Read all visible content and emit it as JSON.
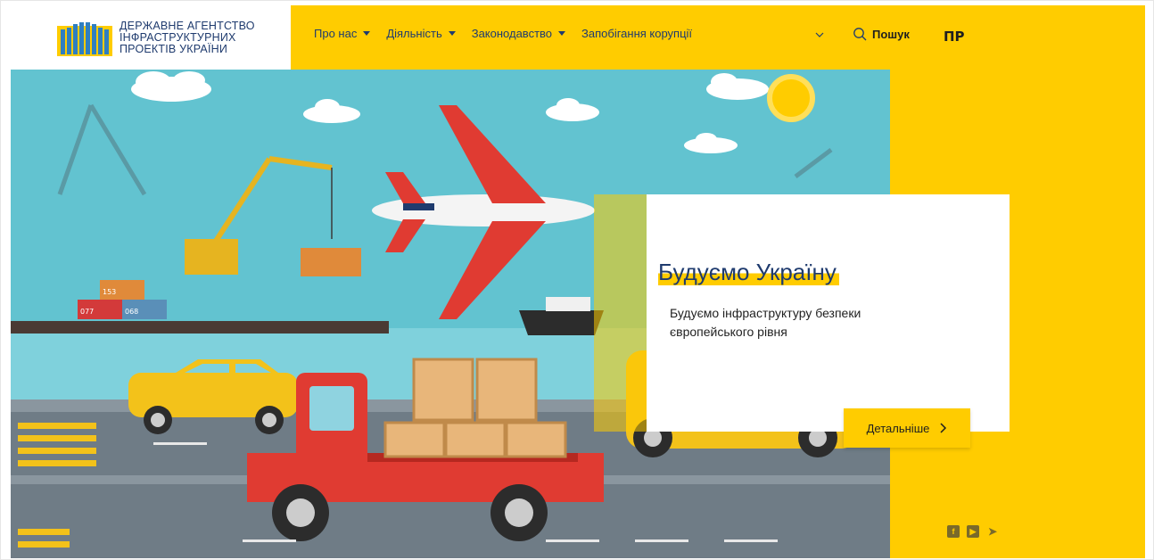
{
  "header": {
    "logo_lines": [
      "ДЕРЖАВНЕ АГЕНТСТВО",
      "ІНФРАСТРУКТУРНИХ",
      "ПРОЕКТІВ УКРАЇНИ"
    ],
    "nav": [
      {
        "label": "Про нас",
        "has_dropdown": true
      },
      {
        "label": "Діяльність",
        "has_dropdown": true
      },
      {
        "label": "Законодавство",
        "has_dropdown": true
      },
      {
        "label": "Запобігання корупції",
        "has_dropdown": false
      }
    ],
    "search_label": "Пошук",
    "brand_icon": "ПР"
  },
  "hero": {
    "title": "Будуємо Україну",
    "subtitle": "Будуємо інфраструктуру безпеки європейського рівня",
    "cta_label": "Детальніше",
    "container_labels": [
      "153",
      "077",
      "068"
    ]
  },
  "social": [
    {
      "icon": "facebook-icon",
      "glyph": "f"
    },
    {
      "icon": "youtube-icon",
      "glyph": "▶"
    },
    {
      "icon": "telegram-icon",
      "glyph": "➤"
    }
  ],
  "colors": {
    "accent": "#ffcc00",
    "navy": "#1f3b6e",
    "sky": "#62c3d0",
    "road": "#6f7c86",
    "truck": "#e03b32"
  }
}
